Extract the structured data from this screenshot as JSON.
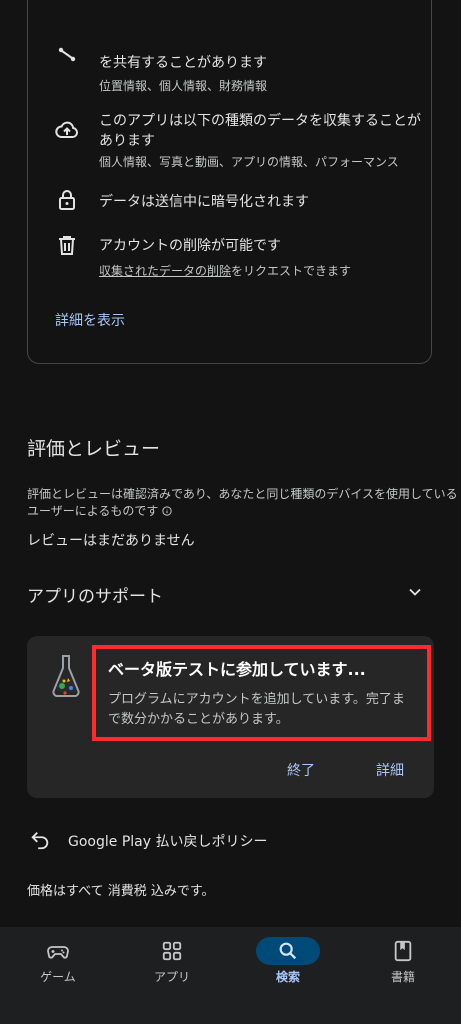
{
  "data_safety": {
    "share_line": "を共有することがあります",
    "share_types": "位置情報、個人情報、財務情報",
    "collect_line1": "このアプリは以下の種類のデータを収集することが",
    "collect_line2": "あります",
    "collect_types": "個人情報、写真と動画、アプリの情報、パフォーマンス",
    "encryption": "データは送信中に暗号化されます",
    "deletion": "アカウントの削除が可能です",
    "deletion_link": "収集されたデータの削除",
    "deletion_suffix": "をリクエストできます",
    "details_link": "詳細を表示"
  },
  "ratings": {
    "title": "評価とレビュー",
    "desc_line1": "評価とレビューは確認済みであり、あなたと同じ種類のデバイスを使用している",
    "desc_line2": "ユーザーによるものです",
    "no_reviews": "レビューはまだありません"
  },
  "support": {
    "title": "アプリのサポート"
  },
  "beta": {
    "title": "ベータ版テストに参加しています...",
    "body_line1": "プログラムにアカウントを追加しています。完了ま",
    "body_line2": "で数分かかることがあります。",
    "end_button": "終了",
    "details_button": "詳細"
  },
  "refund": {
    "label": "Google Play 払い戻しポリシー"
  },
  "tax_note": "価格はすべて 消費税 込みです。",
  "nav": {
    "items": [
      {
        "label": "ゲーム",
        "icon": "gamepad-icon"
      },
      {
        "label": "アプリ",
        "icon": "apps-grid-icon"
      },
      {
        "label": "検索",
        "icon": "search-icon",
        "active": true
      },
      {
        "label": "書籍",
        "icon": "book-icon"
      }
    ]
  },
  "colors": {
    "accent": "#a8c7fa",
    "highlight": "#ff2a2a",
    "active_pill": "#004a77"
  }
}
